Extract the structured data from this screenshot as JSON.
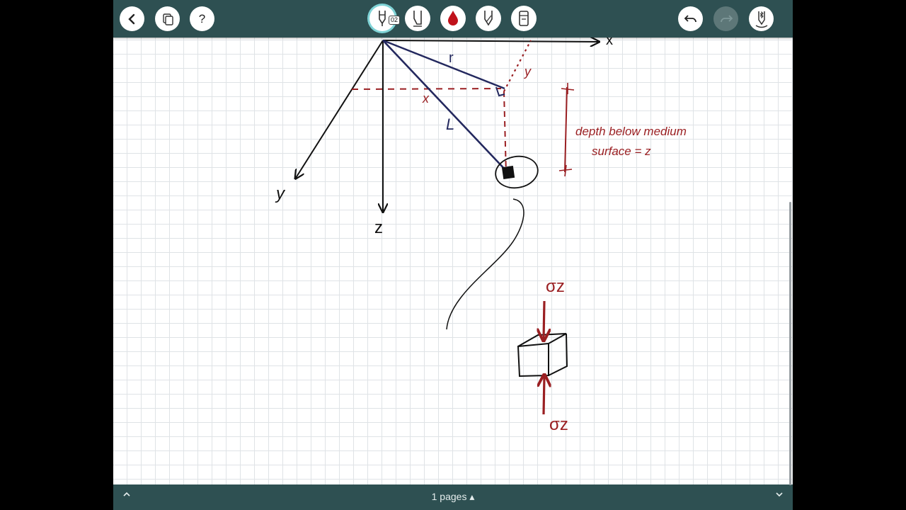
{
  "toolbar": {
    "tool_badge": "02",
    "help_label": "?",
    "colors": {
      "bar": "#2e5052",
      "ink_red": "#9a1f22",
      "ink_navy": "#23285e"
    }
  },
  "icons": [
    "back-icon",
    "pages-icon",
    "help-icon",
    "pen-icon",
    "highlighter-icon",
    "color-drop-icon",
    "pencil-icon",
    "eraser-icon",
    "undo-icon",
    "redo-icon",
    "bluetooth-stylus-icon"
  ],
  "sketch": {
    "axis_x": "x",
    "axis_y": "y",
    "axis_z": "z",
    "label_r": "r",
    "label_L": "L",
    "label_x_proj": "x",
    "label_y_proj": "y",
    "depth_note_line1": "depth below medium",
    "depth_note_line2": "surface = z",
    "sigma_top": "σz",
    "sigma_bottom": "σz"
  },
  "footer": {
    "pages_label": "1 pages ▴"
  }
}
